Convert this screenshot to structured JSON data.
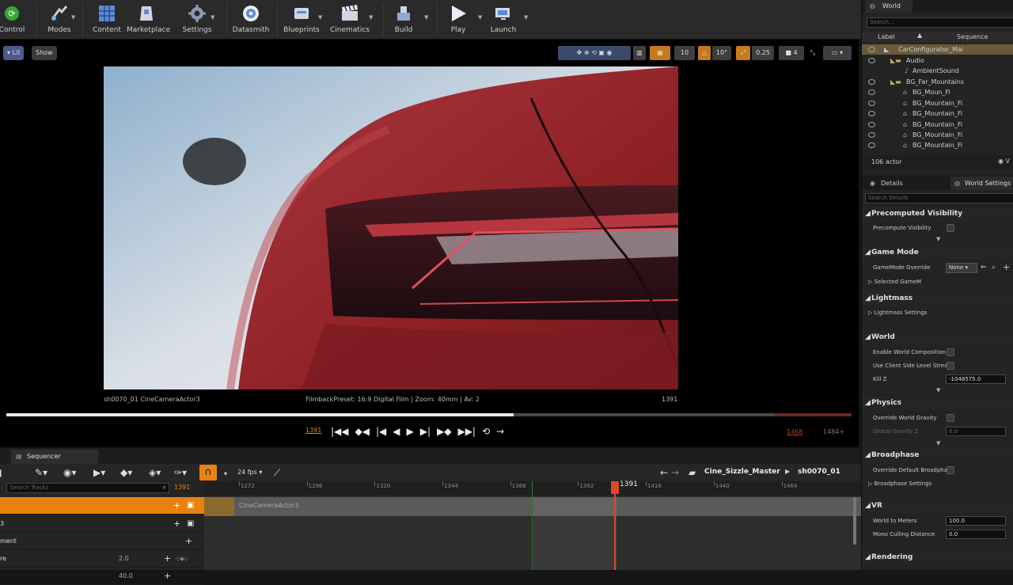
{
  "toolbar": {
    "items": [
      {
        "label": "Control",
        "icon": "source-control-icon"
      },
      {
        "label": "Modes",
        "icon": "modes-icon"
      },
      {
        "label": "Content",
        "icon": "content-icon"
      },
      {
        "label": "Marketplace",
        "icon": "marketplace-icon"
      },
      {
        "label": "Settings",
        "icon": "settings-icon"
      },
      {
        "label": "Datasmith",
        "icon": "datasmith-icon"
      },
      {
        "label": "Blueprints",
        "icon": "blueprints-icon"
      },
      {
        "label": "Cinematics",
        "icon": "cinematics-icon"
      },
      {
        "label": "Build",
        "icon": "build-icon"
      },
      {
        "label": "Play",
        "icon": "play-icon"
      },
      {
        "label": "Launch",
        "icon": "launch-icon"
      }
    ]
  },
  "viewport": {
    "lit_label": "Lit",
    "show_label": "Show",
    "grid_snap": "10",
    "rot_snap": "10°",
    "scale_snap": "0.25",
    "camera_speed": "4",
    "shot_camera": "sh0070_01  CineCameraActor3",
    "filmback": "FilmbackPreset: 16:9 Digital Film | Zoom: 40mm | Av: 2",
    "frame": "1391",
    "current_frame": "1391",
    "end_frame_red": "1468",
    "end_frame": "1484+",
    "playhead_progress": 0.6
  },
  "sequencer": {
    "tab_label": "Sequencer",
    "fps": "24 fps",
    "breadcrumb_master": "Cine_Sizzle_Master",
    "breadcrumb_shot": "sh0070_01",
    "search_placeholder": "Search Tracks",
    "search_frame": "1391",
    "playhead_label": "1391",
    "ruler": [
      "1272",
      "1296",
      "1320",
      "1344",
      "1368",
      "1392",
      "1416",
      "1440",
      "1464"
    ],
    "tracks": [
      {
        "label": "",
        "value": ""
      },
      {
        "label": "3",
        "value": ""
      },
      {
        "label": "ment",
        "value": ""
      },
      {
        "label": "re",
        "value": "2.0"
      },
      {
        "label": "",
        "value": "40.0"
      }
    ],
    "camera_section": "CineCameraActor3"
  },
  "outliner": {
    "tab": "World",
    "search_placeholder": "Search...",
    "col_label": "Label",
    "col_sequence": "Sequence",
    "rows": [
      {
        "label": "CarConfigurator_Mai",
        "indent": 0
      },
      {
        "label": "Audio",
        "indent": 1
      },
      {
        "label": "AmbientSound",
        "indent": 2
      },
      {
        "label": "BG_Far_Mountains",
        "indent": 1
      },
      {
        "label": "BG_Moun_Fi",
        "indent": 2
      },
      {
        "label": "BG_Mountain_Fi",
        "indent": 2
      },
      {
        "label": "BG_Mountain_Fi",
        "indent": 2
      },
      {
        "label": "BG_Mountain_Fi",
        "indent": 2
      },
      {
        "label": "BG_Mountain_Fi",
        "indent": 2
      },
      {
        "label": "BG_Mountain_Fi",
        "indent": 2
      }
    ],
    "actor_count": "106 actor",
    "view_label": "V"
  },
  "details": {
    "tab_details": "Details",
    "tab_world": "World Settings",
    "search_placeholder": "Search Details",
    "sections": {
      "precomputed": "Precomputed Visibility",
      "precompute_vis": "Precompute Visibility",
      "game_mode": "Game Mode",
      "gamemode_override": "GameMode Override",
      "gamemode_value": "None",
      "selected_gamemode": "Selected GameM",
      "lightmass": "Lightmass",
      "lightmass_settings": "Lightmass Settings",
      "world": "World",
      "enable_world_comp": "Enable World Composition",
      "client_side_level": "Use Client Side Level Strea",
      "kill_z": "Kill Z",
      "kill_z_value": "-1048575.0",
      "physics": "Physics",
      "override_gravity": "Override World Gravity",
      "global_gravity": "Global Gravity Z",
      "global_gravity_value": "0.0",
      "broadphase": "Broadphase",
      "override_broadphase": "Override Default Broadpha",
      "broadphase_settings": "Broadphase Settings",
      "vr": "VR",
      "world_to_meters": "World to Meters",
      "world_to_meters_value": "100.0",
      "mono_culling": "Mono Culling Distance",
      "mono_culling_value": "0.0",
      "rendering": "Rendering"
    }
  },
  "colors": {
    "accent_orange": "#e8820f",
    "playhead_red": "#e0472f",
    "car_red": "#9a2a2f"
  }
}
